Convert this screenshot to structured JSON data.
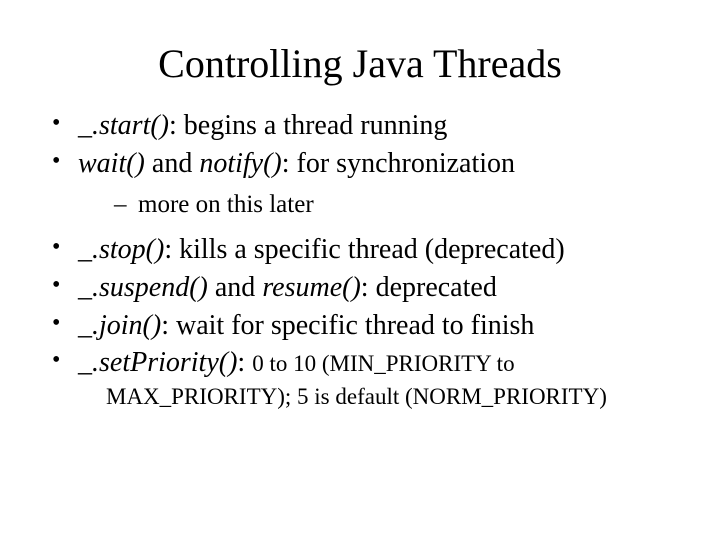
{
  "title": "Controlling Java Threads",
  "bullets": [
    {
      "italic": "_.start()",
      "rest": ": begins a thread running"
    },
    {
      "italic": "wait()",
      "mid": " and ",
      "italic2": "notify()",
      "rest": ": for synchronization",
      "sub": "more on this later"
    },
    {
      "italic": "_.stop()",
      "rest": ": kills a specific thread (deprecated)"
    },
    {
      "italic": "_.suspend()",
      "mid": " and ",
      "italic2": "resume()",
      "rest": ": deprecated"
    },
    {
      "italic": "_.join()",
      "rest": ": wait for specific thread to finish"
    },
    {
      "italic": "_.setPriority()",
      "rest": ": ",
      "small": "0 to 10 (MIN_PRIORITY to",
      "smallCont": "MAX_PRIORITY); 5 is default (NORM_PRIORITY)"
    }
  ]
}
